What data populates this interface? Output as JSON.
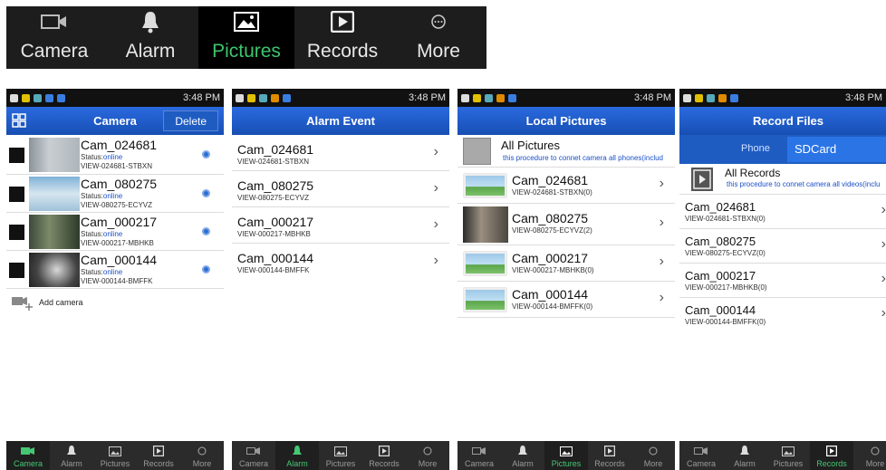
{
  "big_tabbar": {
    "tabs": [
      {
        "label": "Camera",
        "icon": "video-camera-icon",
        "active": false
      },
      {
        "label": "Alarm",
        "icon": "bell-icon",
        "active": false
      },
      {
        "label": "Pictures",
        "icon": "picture-icon",
        "active": true
      },
      {
        "label": "Records",
        "icon": "play-icon",
        "active": false
      },
      {
        "label": "More",
        "icon": "more-circle-icon",
        "active": false
      }
    ]
  },
  "status_bar": {
    "time": "3:48 PM"
  },
  "bottom_nav": {
    "tabs": [
      "Camera",
      "Alarm",
      "Pictures",
      "Records",
      "More"
    ]
  },
  "camera_screen": {
    "title": "Camera",
    "delete_label": "Delete",
    "status_label": "Status:",
    "cameras": [
      {
        "name": "Cam_024681",
        "status": "online",
        "id": "VIEW-024681-STBXN"
      },
      {
        "name": "Cam_080275",
        "status": "online",
        "id": "VIEW-080275-ECYVZ"
      },
      {
        "name": "Cam_000217",
        "status": "online",
        "id": "VIEW-000217-MBHKB"
      },
      {
        "name": "Cam_000144",
        "status": "online",
        "id": "VIEW-000144-BMFFK"
      }
    ],
    "add_label": "Add camera"
  },
  "alarm_screen": {
    "title": "Alarm Event",
    "items": [
      {
        "name": "Cam_024681",
        "id": "VIEW-024681-STBXN"
      },
      {
        "name": "Cam_080275",
        "id": "VIEW-080275-ECYVZ"
      },
      {
        "name": "Cam_000217",
        "id": "VIEW-000217-MBHKB"
      },
      {
        "name": "Cam_000144",
        "id": "VIEW-000144-BMFFK"
      }
    ]
  },
  "pictures_screen": {
    "title": "Local Pictures",
    "all_title": "All Pictures",
    "all_sub": "this procedure to connet camera all phones(includ",
    "items": [
      {
        "name": "Cam_024681",
        "id": "VIEW-024681-STBXN(0)"
      },
      {
        "name": "Cam_080275",
        "id": "VIEW-080275-ECYVZ(2)"
      },
      {
        "name": "Cam_000217",
        "id": "VIEW-000217-MBHKB(0)"
      },
      {
        "name": "Cam_000144",
        "id": "VIEW-000144-BMFFK(0)"
      }
    ]
  },
  "records_screen": {
    "title": "Record Files",
    "tab_phone": "Phone",
    "tab_sdcard": "SDCard",
    "all_title": "All Records",
    "all_sub": "this procedure to connet camera all videos(inclu",
    "items": [
      {
        "name": "Cam_024681",
        "id": "VIEW-024681-STBXN(0)"
      },
      {
        "name": "Cam_080275",
        "id": "VIEW-080275-ECYVZ(0)"
      },
      {
        "name": "Cam_000217",
        "id": "VIEW-000217-MBHKB(0)"
      },
      {
        "name": "Cam_000144",
        "id": "VIEW-000144-BMFFK(0)"
      }
    ]
  },
  "colors": {
    "accent_green": "#3ec46d",
    "title_blue": "#1a58c8",
    "status_online": "#1a50c8"
  }
}
